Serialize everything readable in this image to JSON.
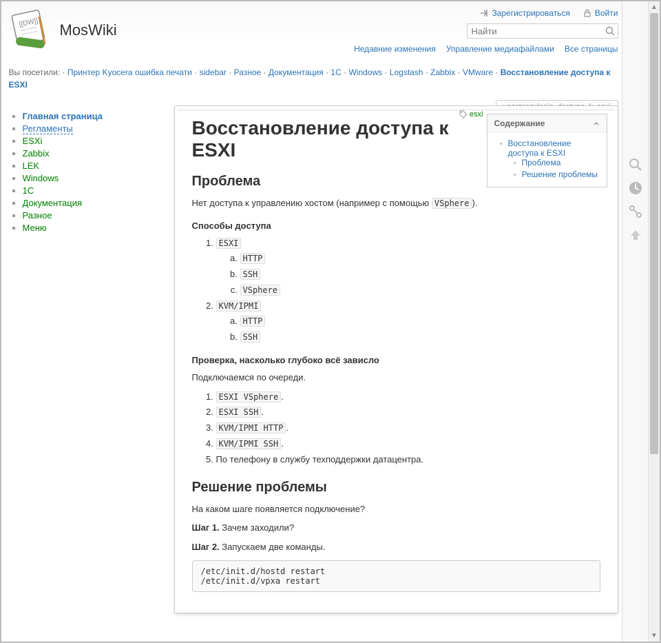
{
  "site": {
    "title": "MosWiki",
    "page_id": "vosstanovlenie_dostupa_k_esxi"
  },
  "user_tools": {
    "register": "Зарегистрироваться",
    "login": "Войти"
  },
  "search": {
    "placeholder": "Найти"
  },
  "site_tools": {
    "recent": "Недавние изменения",
    "media": "Управление медиафайлами",
    "all": "Все страницы"
  },
  "breadcrumbs": {
    "prefix": "Вы посетили:",
    "items": [
      "Принтер Kyocera ошибка печати",
      "sidebar",
      "Разное",
      "Документация",
      "1C",
      "Windows",
      "Logstash",
      "Zabbix",
      "VMware"
    ],
    "current": "Восстановление доступа к ESXI"
  },
  "sidebar": {
    "items": [
      "Главная страница",
      "Регламенты",
      "ESXi",
      "Zabbix",
      "LEK",
      "Windows",
      "1С",
      "Документация",
      "Разное",
      "Меню"
    ]
  },
  "tag": "esxi",
  "toc": {
    "title": "Содержание",
    "items": [
      {
        "label": "Восстановление доступа к ESXI",
        "children": [
          "Проблема",
          "Решение проблемы"
        ]
      }
    ]
  },
  "article": {
    "h1": "Восстановление доступа к ESXI",
    "h2_problem": "Проблема",
    "problem_intro_1": "Нет доступа к управлению хостом (например с помощью ",
    "problem_vsphere": "VSphere",
    "problem_intro_2": ").",
    "h4_access": "Способы доступа",
    "access": [
      {
        "label": "ESXI",
        "sub": [
          "HTTP",
          "SSH",
          "VSphere"
        ]
      },
      {
        "label": "KVM/IPMI",
        "sub": [
          "HTTP",
          "SSH"
        ]
      }
    ],
    "h4_check": "Проверка, насколько глубоко всё зависло",
    "check_intro": "Подключаемся по очереди.",
    "check_items": [
      {
        "code": "ESXI VSphere",
        "suffix": "."
      },
      {
        "code": "ESXI SSH",
        "suffix": "."
      },
      {
        "code": "KVM/IPMI HTTP",
        "suffix": "."
      },
      {
        "code": "KVM/IPMI SSH",
        "suffix": "."
      },
      {
        "text": "По телефону в службу техподдержки датацентра."
      }
    ],
    "h2_solution": "Решение проблемы",
    "solution_q": "На каком шаге появляется подключение?",
    "step1_label": "Шаг 1.",
    "step1_text": " Зачем заходили?",
    "step2_label": "Шаг 2.",
    "step2_text": " Запускаем две команды.",
    "codeblock": "/etc/init.d/hostd restart\n/etc/init.d/vpxa restart"
  }
}
